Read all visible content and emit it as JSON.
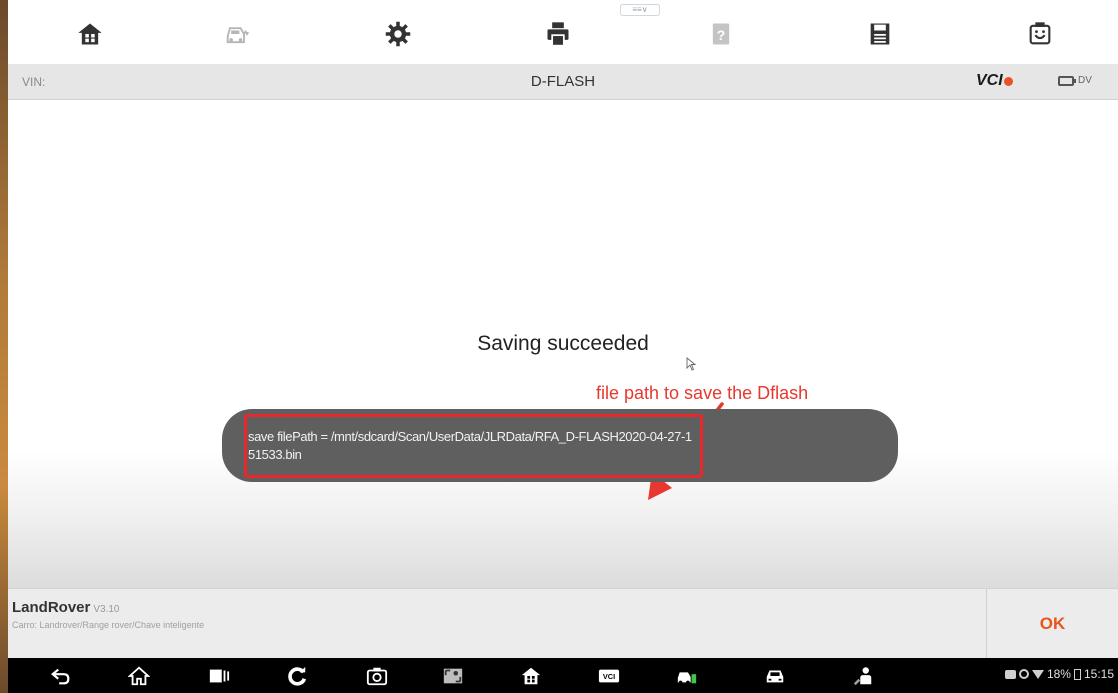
{
  "toolbar": {
    "buttons": [
      "home-icon",
      "vehicle-icon",
      "settings-icon",
      "print-icon",
      "help-icon",
      "save-icon",
      "screenshot-icon"
    ],
    "handle_label": "≡≡∨"
  },
  "titlebar": {
    "vin_label": "VIN:",
    "title": "D-FLASH",
    "vci_label": "VCI",
    "battery_label": "DV"
  },
  "main": {
    "status_message": "Saving succeeded",
    "annotation": "file path to save the Dflash",
    "annotation_color": "#e8372f",
    "toast_text": "save filePath = /mnt/sdcard/Scan/UserData/JLRData/RFA_D-FLASH2020-04-27-151533.bin"
  },
  "infobar": {
    "make": "LandRover",
    "version": "V3.10",
    "path": "Carro: Landrover/Range rover/Chave inteligente",
    "ok_label": "OK",
    "ok_color": "#e8541c"
  },
  "navbar": {
    "buttons": [
      "back-icon",
      "home-icon",
      "recent-apps-icon",
      "refresh-icon",
      "camera-icon",
      "screen-capture-icon",
      "diag-home-icon",
      "vci-icon",
      "vehicle-check-icon",
      "car-icon",
      "mechanic-icon"
    ],
    "battery_percent": "18%",
    "time": "15:15"
  }
}
